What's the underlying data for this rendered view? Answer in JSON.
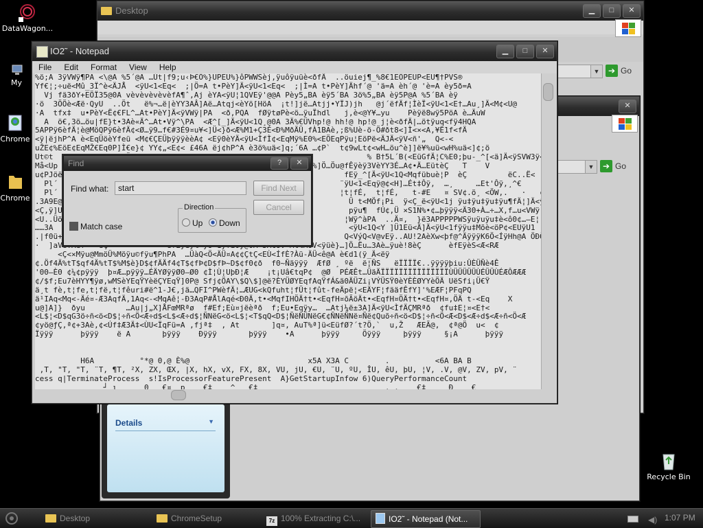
{
  "desktop": {
    "icons": [
      {
        "label": "DataWagon..."
      },
      {
        "label": "My"
      },
      {
        "label": "Chrome"
      },
      {
        "label": "Chrome"
      },
      {
        "label": "Recycle Bin"
      }
    ]
  },
  "explorer_back": {
    "title": "Desktop",
    "go_label": "Go"
  },
  "explorer_mid": {
    "go_label": "Go",
    "details_label": "Details"
  },
  "notepad": {
    "title": "IO2˜ - Notepad",
    "menu": [
      "File",
      "Edit",
      "Format",
      "View",
      "Help"
    ],
    "content": "%ö;A 3ÿVWÿ¶PA <\\@A %5´@A …Út|f9;u‹Þ€Ô%}ÜPEÜ%}ôPWWSèj,ÿuôÿuüè<ðfÄ  ..öuiej¶_%8€1EÔPEÜP<EÜ¶†PVS®\nYf€¦;÷uë<Mû_3Ï^è<ÄJÅ  <ÿU<1<Eq<  ;|Ö=A t•PèY]Ä<ÿU<1<Eq<  ;|Ì=A t•PèY]Ähf´@ 'ä=A èh´@ 'è=A èy5ð=A \n  Vj fä3ðY+EÖÏ35@0A vèvèvèvèvèfA¶ˆ,Aj èYA<ÿU¦1QVEÿ'@@A Pèy5„BA èÿ5´BA 3ö%5„BA èÿ5P@A %5´BA èÿ\n·ö  3ÖÖè<Æë·QyU  ..Öt   ë%¬…ë|èYY3AÂ]Aë…Atqj<èYö[HöA  ¡t!]jë…Atjj•YÏJ)jh   @j´ëfÄf¦ÌèÏ<ÿU<1<E†…Au¸]Ä<M¢<U@\n·A  tfx‡  u•PèY<Ë¢€FL^…At•PèY]Ä<ÿVWÿ|PA  <ð,PQA  fØÿtøPè<ö…ÿuÏhdl   j,è<@Y¥…yu    Pèÿë8wÿ5PöA è…ÄuW\n  A  ö€,3ö…öu|fE}t•3Aè«Ä^…At•Vÿ^\\PA  <Æ^[_]Ä<ÿU<1Q¸@0A 3Ä%€ÜVhp!@ hh!@ hp!@ j¦è<ðfÄ|…ötÿuq<fÿ4HQA\n5APPÿ6èfÄ¦è@MöQPÿ6èfÄ¢<Ø…ÿ9…f€#3É9¤u¥<]Ü<}ð<Æ%M1+Ç3É<Ð%MðÄÜ‚fÀ1BAè,;ß%Uè-ö-Ö#ðt8<]Ì<×<A,¥Ë1f<fÄ\n<ÿ|ëjhP^A è<EqÜöèYfeü <M¢€ÇEÜþÿÿÿèèA¢ <Eÿ0èYÄ<ÿU<ÌfÌ¢<EqMÿ%E0%<EÖEqPÿu¦EöPë<ÄJÄ<ÿV<ñ'„  Q<-<\nuŽE¢%EöE¢EqMŽ€Eq0P]Ì€e}¢ YY¢„<E¢< £46A ëj¢hP^A è3ö%uä<]q;´6A …¢P`  t¢9wLt¢<wH…öu^è]]ë¥%uü<wH%uä<]¢;ö\nUt©t     ¦  ..Uÿ  ··Ö                                                    % B†5L´B(<EüGfÄ¦C%E0;þu-_^[<ä]Ä<ÿSVW3ÿ<Ç<Ì\nMå<Up  Ë(èPÿ·  Pÿ^…ýÿ  <M¢MM   ..ö   Ñ<EUtÄ¢èüöð    fÄ¦ÊEè%<ð%]Ö…Öu@fÊÿèÿ3VèYY3É…A¢•Ä…EütèÇ   T    V\nu¢PJöë                                                              fEÿ_^[Ä<ÿU<1Q<Mqfübuè¦P  èÇ         ëC..Ë<\n  Pl´ ÿ                                                            ¨ÿU<1<Eqÿ@¢<H]…Ét‡Ôÿ,  …¸     …Et'Ôÿ‚¸^€        …Et'\n  Pl´                                                              ¦t¦fÉ,  t¦fÉ,   t-#E   ¤ SV¢.ö¸ <ÖW‚.   ·   ¢öt\n.3A9E@                                                               Ü t<MÖf¡Pi  ÿ<Ç_ë<ÿU<1j ÿu‡ÿu‡ÿu‡ÿu¶fÄ¦]Ä<ÿU<\n<Ç,ÿ]U                                                               pÿu¶  fÚ¢,Ü ×S1N%•¢…þÿÿÿ<Ä30+À…÷…X,f…u<VWÿ\n<U..Üö                                                              ¦Wÿ^àPA  ..Ä¤,  }ë3APPPPPWSÿuÿuÿu‡è<ô0¢…—E¦  ·\n……3A                                                                 <ÿU<1Q<Y ]Ü1Eü<Ä]Ä<ÿU<1fÿÿu‡Mõè<öP¢<EUÿU1\n.|f0ü+                                                              Q<VýQ<V@vEÿ..AU!2AèXw<þf@^ÄÿÿÿK6Ö<ÍÿHh@A ÖÐÖ(€tè<\n·  ]aVèYAèf   èÇ             ëfÈÿèÿ%<ÿU<1ÿfî0ÿ@0A 3Ä€ÜV<Ml%MöV<ÿüè}…]Ö…Ëu…3Aè…ÿuè!8èÇ      èfEÿèS<Æ<RÆ\n     <Ç<×Mÿu@MmöÜ%Möÿu©fÿu¶PhPA  …ÜàQ<Ö<ÄÜ¤A¢¢ÇtÇ<EÙ<ÍfÈ?Àü-ÄÜ<ê@A è€d1(ÿ_Ä<ëÿ\n¢.Öf4Ä%tT$qf4Ä%tT$%M$è}D$¢fÄÄf4¢T$¢fÞ¢D$fÞ~D$¢f0¢ð  f0~Ñäÿÿÿ  ÆfØ ¸ ºë  ë¦ÑS   ëÏÏÏÏ€..ÿÿÿÿþiu:ÛÈÜÑè4Ê\n'00—È0 ¢¼¢pÿÿÿ  þ¤Æ…pÿÿÿ…ÉÄYØÿÿØ0—Ø0 ¢Ì¦Ù¦UþÐ¦Æ    ¡t¡Uâ€tqP¢  @Ø  PÉÆÊt…ÜäÄÏÏÏÏÏÏÏÏÏÏÏÏÏÏÏÙÜÜÜÜÜÙÉÜÜÙÉÆÔÆÆÆ\n¢/$f;Eu7èHYY¶ÿø,wMSèYEqŸYèëÇYEqŸ]0P@ Sfj¢ÖAY\\$Q\\$]@ë?ÈYÜØYEqfAqŸfÁ&ä0ÄÜZi¡VÝÜSŸ0èYÈÈØYYèÖÄ UëSfi¡Ü€Ÿ\nä¸t fè,t¦fe,t¦fë,t¦fêuri#ë^1-J€,jä…QFI^PWèfÄ¦…ÆUG<kQfuht¦fÜt¦fût-feÄpë¦<EÄYF¦fääfÊfY]'%EÆF¦PFqPQ\nä¹IAq<Mq<-Äé¤-Æ3AqfÄ,1Aq<-<MqAê¦-Ð3AqP#ÅlAqé<Ð0Ä,t•<MqfIHÖÄ†t•<EqfH¤õÃöÄt•<EqfH¤ÖÄ†t•<EqfH¤,ÖÄ t-<Eq    X\nu@]A]}  ðyu         …Au|j„X]ÅFœMRªø  f#Ef;Eù¤jëèªð  f;Eu•Eqÿy…  …Atj¼ë±3A]Ä<ÿU<ÌfÄÇMRªð  ¢fu‡E¦¤<E†<\n<L$¦<D$qG3ö÷ñ<ö<D$¦÷ñ<Ö<Æ÷d$<L$<Æ÷d$¦ÑNëG<ö<L$¦<T$qQ<D$¦ÑëÑÜNëG€¢ÑNëÑNë¤Ñë¢Quõ÷ñ<ö<D$¦÷ñ<Ö<Æ<D$<Æ÷d$<Æ÷ñ<Ö<Æ\n¢yö@ƒÇ,ª¢+3Aè,¢<Úf‡Æ3Ä‡<ÙU<ÏqFü=A ,fjª‡  , At       ]q¤, AuT%ª]ü<EüfØ?´t?Ö,`  u,Ž   ÆEÃ@,  ¢ª@Ö  u<  ¢\nÏÿÿÿ      þÿÿÿ    ë A       þÿÿÿ    Ðÿÿÿ       þÿÿÿ    •A      þÿÿÿ     Öÿÿÿ     þÿÿÿ     §¡A      þÿÿÿ\n\n\n          H6A          °*@ 0,@ È%@                          x5A X3A C        .          <6A BA B\n ,T, \"T, \"T, ¨T, ¶T, ²X, ZX, ŒX, |X, hX, vX, FX, 8X, VU, jU, €U, ¨U, ºU, ÎU, êU, þU, ¦V, .V, @V, ZV, pV, ¨\ncess q|TerminateProcess  s!IsProcessorFeaturePresent  A}GetStartupInfow 6)QueryPerformanceCount\n               ┘ ι      0   €¤  p    €‡    ^   €‡                            ‚ ‚    €‡     Ð    €"
  },
  "find_dialog": {
    "title": "Find",
    "find_what_label": "Find what:",
    "find_what_value": "start",
    "find_next_label": "Find Next",
    "cancel_label": "Cancel",
    "direction_label": "Direction",
    "up_label": "Up",
    "down_label": "Down",
    "direction_selected": "Down",
    "match_case_label": "Match case",
    "match_case_checked": false
  },
  "taskbar": {
    "items": [
      {
        "label": "Desktop"
      },
      {
        "label": "ChromeSetup"
      },
      {
        "label": "100% Extracting C:\\..."
      },
      {
        "label": "IO2˜ - Notepad (Not..."
      }
    ],
    "clock": "1:07 PM"
  },
  "colors": {
    "window_dark": "#2d2d2d",
    "notepad_bg": "#e4e4e4",
    "go_green": "#2e9a2e",
    "details_panel": "#cde6f2",
    "taskbar": "#151515"
  }
}
